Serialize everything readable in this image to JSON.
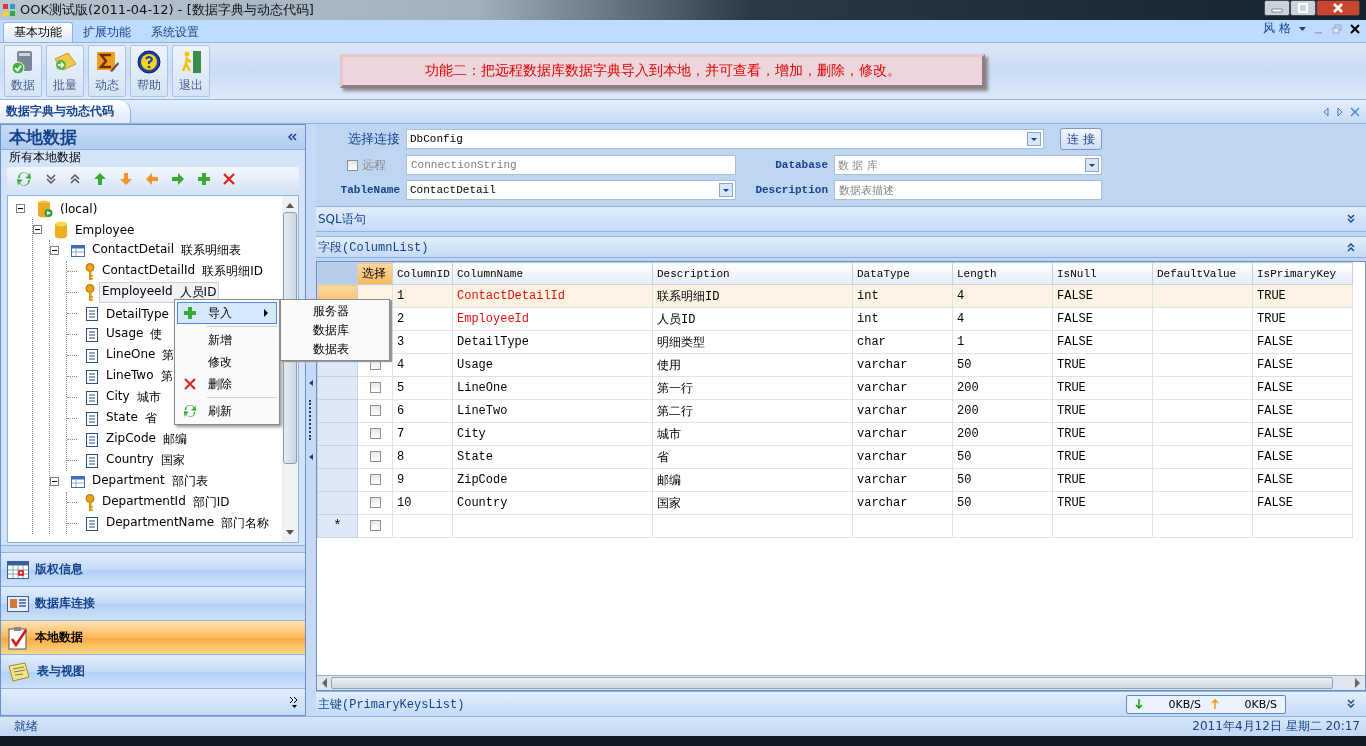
{
  "window": {
    "title": "OOK测试版(2011-04-12) - [数据字典与动态代码]"
  },
  "menu_tabs": [
    {
      "label": "基本功能",
      "selected": true
    },
    {
      "label": "扩展功能",
      "selected": false
    },
    {
      "label": "系统设置",
      "selected": false
    }
  ],
  "style_menu": {
    "label": "风 格"
  },
  "toolbar_buttons": [
    {
      "label": "数据",
      "kind": "data"
    },
    {
      "label": "批量",
      "kind": "batch"
    },
    {
      "label": "动态",
      "kind": "dynamic"
    },
    {
      "label": "帮助",
      "kind": "help"
    },
    {
      "label": "退出",
      "kind": "exit"
    }
  ],
  "banner": {
    "text": "功能二：把远程数据库数据字典导入到本地，并可查看，增加，删除，修改。"
  },
  "document_tab": {
    "label": "数据字典与动态代码"
  },
  "left_panel": {
    "title": "本地数据",
    "group_label": "所有本地数据",
    "tree": [
      {
        "name": "(local)",
        "kind": "server",
        "expanded": true,
        "selected": false,
        "children": [
          {
            "name": "Employee",
            "kind": "database",
            "expanded": true,
            "selected": false,
            "children": [
              {
                "name": "ContactDetail",
                "desc": "联系明细表",
                "kind": "table",
                "expanded": true,
                "selected": false,
                "children": [
                  {
                    "name": "ContactDetailId",
                    "desc": "联系明细ID",
                    "kind": "key",
                    "selected": false
                  },
                  {
                    "name": "EmployeeId",
                    "desc": "人员ID",
                    "kind": "key",
                    "selected": true
                  },
                  {
                    "name": "DetailType",
                    "kind": "column",
                    "selected": false
                  },
                  {
                    "name": "Usage",
                    "desc": "使",
                    "kind": "column",
                    "selected": false
                  },
                  {
                    "name": "LineOne",
                    "desc": "第",
                    "kind": "column",
                    "selected": false
                  },
                  {
                    "name": "LineTwo",
                    "desc": "第",
                    "kind": "column",
                    "selected": false
                  },
                  {
                    "name": "City",
                    "desc": "城市",
                    "kind": "column",
                    "selected": false
                  },
                  {
                    "name": "State",
                    "desc": "省",
                    "kind": "column",
                    "selected": false
                  },
                  {
                    "name": "ZipCode",
                    "desc": "邮编",
                    "kind": "column",
                    "selected": false
                  },
                  {
                    "name": "Country",
                    "desc": "国家",
                    "kind": "column",
                    "selected": false
                  }
                ]
              },
              {
                "name": "Department",
                "desc": "部门表",
                "kind": "table",
                "expanded": true,
                "selected": false,
                "children": [
                  {
                    "name": "DepartmentId",
                    "desc": "部门ID",
                    "kind": "key",
                    "selected": false
                  },
                  {
                    "name": "DepartmentName",
                    "desc": "部门名称",
                    "kind": "column",
                    "selected": false
                  }
                ]
              }
            ]
          }
        ]
      }
    ],
    "context_menu": {
      "items": [
        {
          "label": "导入",
          "kind": "plus",
          "selected": true,
          "submenu": true
        },
        {
          "kind": "separator"
        },
        {
          "label": "新增",
          "kind": "plain",
          "selected": false,
          "submenu": false
        },
        {
          "label": "修改",
          "kind": "plain",
          "selected": false,
          "submenu": false
        },
        {
          "label": "删除",
          "kind": "delete",
          "selected": false,
          "submenu": false
        },
        {
          "kind": "separator"
        },
        {
          "label": "刷新",
          "kind": "refresh",
          "selected": false,
          "submenu": false
        }
      ],
      "submenu": [
        {
          "label": "服务器"
        },
        {
          "label": "数据库"
        },
        {
          "label": "数据表"
        }
      ]
    },
    "nav_items": [
      {
        "label": "版权信息",
        "kind": "calendar",
        "selected": false
      },
      {
        "label": "数据库连接",
        "kind": "card",
        "selected": false
      },
      {
        "label": "本地数据",
        "kind": "clipboard",
        "selected": true
      },
      {
        "label": "表与视图",
        "kind": "notepad",
        "selected": false
      }
    ]
  },
  "form": {
    "connection_label": "选择连接",
    "connection_value": "DbConfig",
    "connect_button": "连 接",
    "remote_label": "远程",
    "remote_checked": false,
    "connection_string_placeholder": "ConnectionString",
    "database_label": "Database",
    "database_value": "数 据 库",
    "table_name_label": "TableName",
    "table_name_value": "ContactDetail",
    "description_label": "Description",
    "description_placeholder": "数据表描述"
  },
  "sql_section": {
    "title": "SQL语句"
  },
  "columns_section": {
    "title": "字段(ColumnList)"
  },
  "table": {
    "columns": [
      "选择",
      "ColumnID",
      "ColumnName",
      "Description",
      "DataType",
      "Length",
      "IsNull",
      "DefaultValue",
      "IsPrimaryKey"
    ],
    "rows": [
      {
        "selected": true,
        "key": true,
        "cells": [
          "",
          "1",
          "ContactDetailId",
          "联系明细ID",
          "int",
          "4",
          "FALSE",
          "",
          "TRUE"
        ]
      },
      {
        "selected": false,
        "key": true,
        "cells": [
          "",
          "2",
          "EmployeeId",
          "人员ID",
          "int",
          "4",
          "FALSE",
          "",
          "TRUE"
        ]
      },
      {
        "selected": false,
        "key": false,
        "cells": [
          "",
          "3",
          "DetailType",
          "明细类型",
          "char",
          "1",
          "FALSE",
          "",
          "FALSE"
        ]
      },
      {
        "selected": false,
        "checked": false,
        "key": false,
        "cells": [
          "",
          "4",
          "Usage",
          "使用",
          "varchar",
          "50",
          "TRUE",
          "",
          "FALSE"
        ]
      },
      {
        "selected": false,
        "checked": false,
        "key": false,
        "cells": [
          "",
          "5",
          "LineOne",
          "第一行",
          "varchar",
          "200",
          "TRUE",
          "",
          "FALSE"
        ]
      },
      {
        "selected": false,
        "checked": false,
        "key": false,
        "cells": [
          "",
          "6",
          "LineTwo",
          "第二行",
          "varchar",
          "200",
          "TRUE",
          "",
          "FALSE"
        ]
      },
      {
        "selected": false,
        "checked": false,
        "key": false,
        "cells": [
          "",
          "7",
          "City",
          "城市",
          "varchar",
          "200",
          "TRUE",
          "",
          "FALSE"
        ]
      },
      {
        "selected": false,
        "checked": false,
        "key": false,
        "cells": [
          "",
          "8",
          "State",
          "省",
          "varchar",
          "50",
          "TRUE",
          "",
          "FALSE"
        ]
      },
      {
        "selected": false,
        "checked": false,
        "key": false,
        "cells": [
          "",
          "9",
          "ZipCode",
          "邮编",
          "varchar",
          "50",
          "TRUE",
          "",
          "FALSE"
        ]
      },
      {
        "selected": false,
        "checked": false,
        "key": false,
        "cells": [
          "",
          "10",
          "Country",
          "国家",
          "varchar",
          "50",
          "TRUE",
          "",
          "FALSE"
        ]
      }
    ],
    "new_row": {
      "marker": "*",
      "checked": false
    }
  },
  "primary_keys_section": {
    "title": "主键(PrimaryKeysList)",
    "download": "0KB/S",
    "upload": "0KB/S"
  },
  "status_bar": {
    "left": "就绪",
    "right": "2011年4月12日 星期二 20:17"
  }
}
